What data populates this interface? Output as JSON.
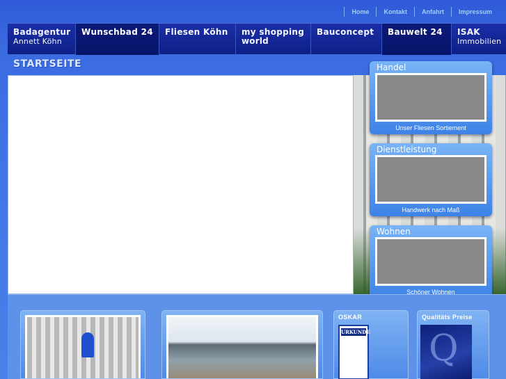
{
  "toplinks": [
    "Home",
    "Kontakt",
    "Anfahrt",
    "Impressum"
  ],
  "nav": [
    {
      "label": "Badagentur",
      "sub": "Annett Köhn"
    },
    {
      "label": "Wunschbad 24",
      "sub": ""
    },
    {
      "label": "Fliesen Köhn",
      "sub": ""
    },
    {
      "label": "my shopping",
      "sub": "world"
    },
    {
      "label": "Bauconcept",
      "sub": ""
    },
    {
      "label": "Bauwelt 24",
      "sub": ""
    },
    {
      "label": "ISAK",
      "sub": "Immobilien"
    }
  ],
  "page_title": "STARTSEITE",
  "cards": [
    {
      "title": "Handel",
      "caption": "Unser Fliesen Sortiement"
    },
    {
      "title": "Dienstleistung",
      "caption": "Handwerk nach Maß"
    },
    {
      "title": "Wohnen",
      "caption": "Schöner Wohnen"
    }
  ],
  "bottom": {
    "oskar_title": "OSKAR",
    "urkunde": "URKUNDE",
    "quality_title": "Qualitäts Preise"
  },
  "colors": {
    "nav_bg": "#0f1f86",
    "accent": "#3f74e6",
    "card": "#5a9af0"
  }
}
